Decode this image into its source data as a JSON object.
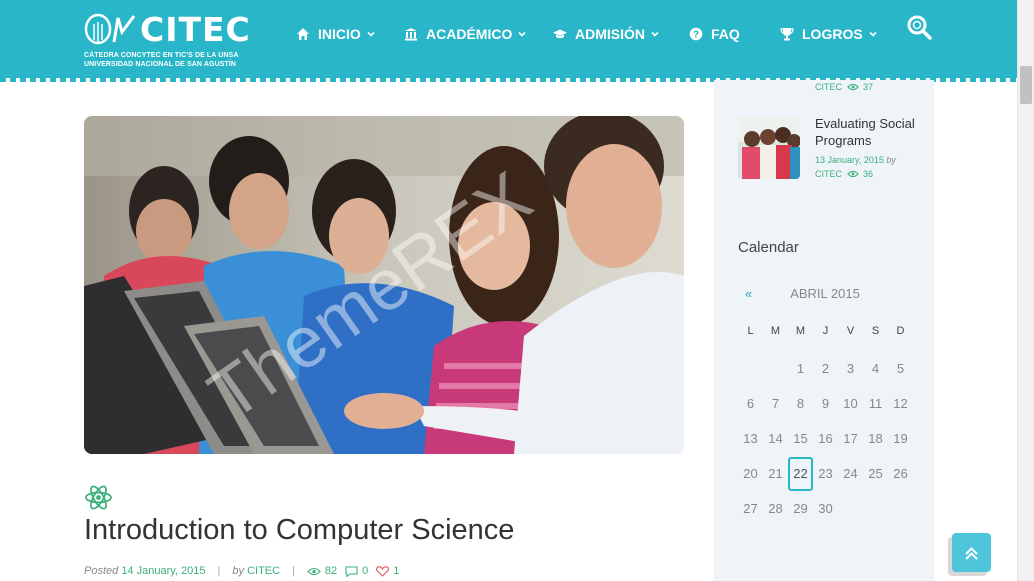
{
  "brand": {
    "name": "CITEC",
    "line1": "CÁTEDRA CONCYTEC EN TIC'S DE LA UNSA",
    "line2": "UNIVERSIDAD NACIONAL DE SAN AGUSTÍN"
  },
  "nav": [
    {
      "label": "INICIO",
      "icon": "home-icon",
      "dropdown": true
    },
    {
      "label": "ACADÉMICO",
      "icon": "bank-icon",
      "dropdown": true
    },
    {
      "label": "ADMISIÓN",
      "icon": "graduation-cap-icon",
      "dropdown": true
    },
    {
      "label": "FAQ",
      "icon": "question-circle-icon",
      "dropdown": false
    },
    {
      "label": "LOGROS",
      "icon": "trophy-icon",
      "dropdown": true
    }
  ],
  "hero": {
    "watermark": "ThemeREX"
  },
  "post": {
    "title": "Introduction to Computer Science",
    "posted_label": "Posted",
    "date": "14 January, 2015",
    "by_label": "by",
    "author": "CITEC",
    "views": "82",
    "comments": "0",
    "likes": "1"
  },
  "sidebar": {
    "prev_post_meta": {
      "author": "CITEC",
      "views": "37"
    },
    "recent_post": {
      "title": "Evaluating Social Programs",
      "date": "13 January, 2015",
      "by_label": "by",
      "author": "CITEC",
      "views": "36"
    },
    "calendar": {
      "title": "Calendar",
      "prev": "«",
      "month": "ABRIL 2015",
      "weekdays": [
        "L",
        "M",
        "M",
        "J",
        "V",
        "S",
        "D"
      ],
      "weeks": [
        [
          "",
          "",
          "1",
          "2",
          "3",
          "4",
          "5"
        ],
        [
          "6",
          "7",
          "8",
          "9",
          "10",
          "11",
          "12"
        ],
        [
          "13",
          "14",
          "15",
          "16",
          "17",
          "18",
          "19"
        ],
        [
          "20",
          "21",
          "22",
          "23",
          "24",
          "25",
          "26"
        ],
        [
          "27",
          "28",
          "29",
          "30",
          "",
          "",
          ""
        ]
      ],
      "today": "22"
    }
  },
  "colors": {
    "header": "#29b6c9",
    "accent_green": "#3ab07a",
    "sidebar_bg": "#eef4f8"
  }
}
